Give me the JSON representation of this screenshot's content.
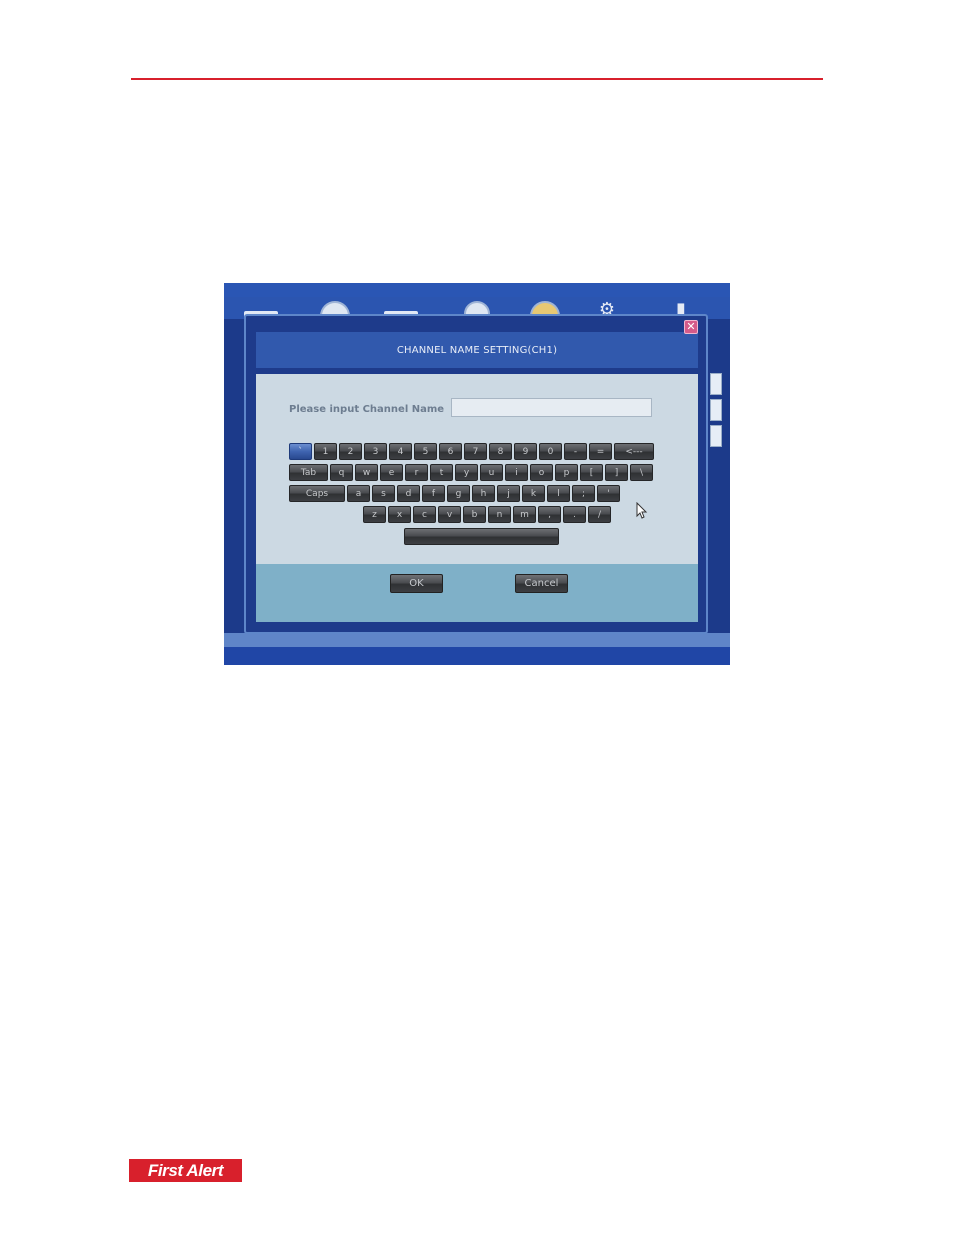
{
  "dialog": {
    "title": "CHANNEL NAME SETTING(CH1)",
    "close_symbol": "✕",
    "channel_label": "Please input Channel Name",
    "channel_value": "",
    "ok_label": "OK",
    "cancel_label": "Cancel"
  },
  "keyboard": {
    "row1": [
      "`",
      "1",
      "2",
      "3",
      "4",
      "5",
      "6",
      "7",
      "8",
      "9",
      "0",
      "-",
      "=",
      "<---"
    ],
    "row2": [
      "Tab",
      "q",
      "w",
      "e",
      "r",
      "t",
      "y",
      "u",
      "i",
      "o",
      "p",
      "[",
      "]",
      "\\"
    ],
    "row3": [
      "Caps",
      "a",
      "s",
      "d",
      "f",
      "g",
      "h",
      "j",
      "k",
      "l",
      ";",
      "'"
    ],
    "row4": [
      "z",
      "x",
      "c",
      "v",
      "b",
      "n",
      "m",
      ",",
      ".",
      "/"
    ],
    "space_label": "",
    "selected_key": "`"
  },
  "icons": [
    "monitor-icon",
    "camera-icon",
    "disk-icon",
    "network-icon",
    "alarm-icon",
    "gear-icon",
    "speaker-icon"
  ],
  "colors": {
    "brand_red": "#d8202c",
    "dialog_blue": "#1e3b8b",
    "panel_gray": "#ccd9e3"
  },
  "logo": {
    "text": "First Alert"
  }
}
